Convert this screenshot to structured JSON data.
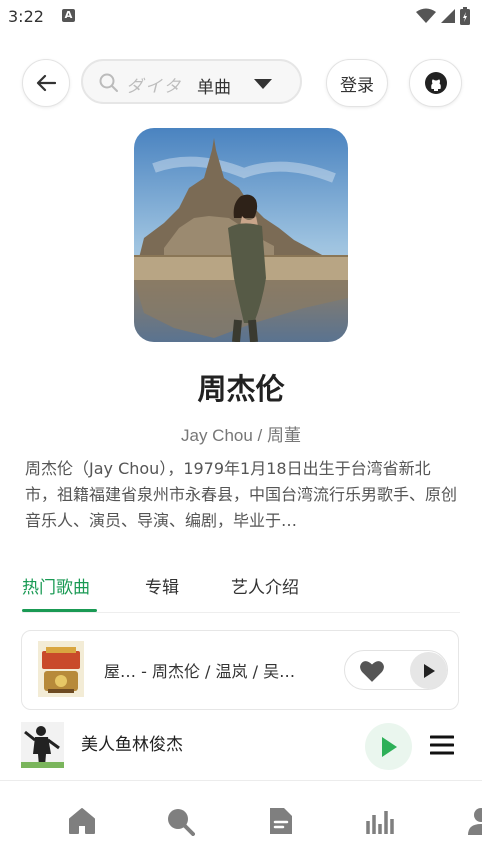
{
  "status_bar": {
    "time": "3:22",
    "notification_badge": "A"
  },
  "header": {
    "search": {
      "placeholder": "ダイタ",
      "type_label": "单曲"
    },
    "login_label": "登录"
  },
  "artist": {
    "name": "周杰伦",
    "alias": "Jay Chou / 周董",
    "bio": "周杰伦（Jay Chou），1979年1月18日出生于台湾省新北市，祖籍福建省泉州市永春县，中国台湾流行乐男歌手、原创音乐人、演员、导演、编剧，毕业于…"
  },
  "tabs": [
    {
      "label": "热门歌曲",
      "active": true
    },
    {
      "label": "专辑",
      "active": false
    },
    {
      "label": "艺人介绍",
      "active": false
    }
  ],
  "songs": [
    {
      "title": "屋…  -  周杰伦 / 温岚 / 吴…"
    }
  ],
  "player": {
    "now_playing": "美人鱼林俊杰"
  },
  "bottom_nav": {
    "items": [
      {
        "icon": "home-icon"
      },
      {
        "icon": "search-icon"
      },
      {
        "icon": "document-icon"
      },
      {
        "icon": "chart-icon"
      },
      {
        "icon": "user-icon"
      }
    ]
  },
  "colors": {
    "accent": "#1a9a54",
    "text": "#222222",
    "muted": "#777777"
  }
}
